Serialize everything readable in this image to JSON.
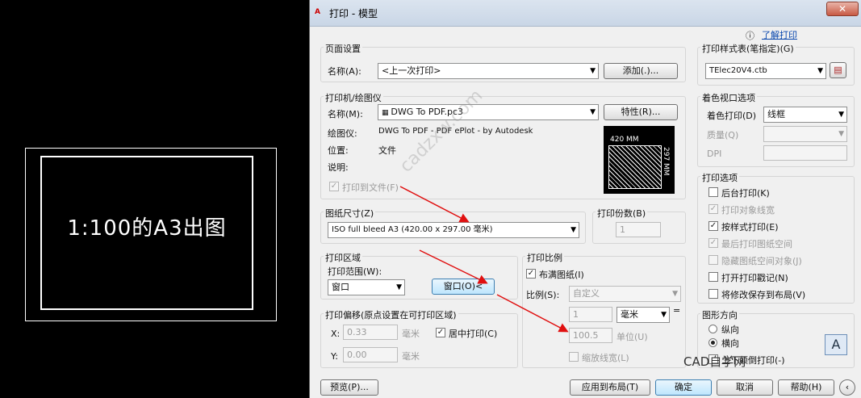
{
  "cad": {
    "drawing_text": "1:100的A3出图"
  },
  "dialog": {
    "title": "打印 - 模型",
    "help_link": "了解打印",
    "page_setup": {
      "group": "页面设置",
      "name_label": "名称(A):",
      "name_value": "<上一次打印>",
      "add_button": "添加(.)..."
    },
    "printer": {
      "group": "打印机/绘图仪",
      "name_label": "名称(M):",
      "name_value": "DWG To PDF.pc3",
      "properties_button": "特性(R)...",
      "plotter_label": "绘图仪:",
      "plotter_value": "DWG To PDF - PDF ePlot - by Autodesk",
      "location_label": "位置:",
      "location_value": "文件",
      "description_label": "说明:",
      "plot_to_file": "打印到文件(F)",
      "preview_width": "420 MM",
      "preview_height": "297 MM"
    },
    "paper_size": {
      "group": "图纸尺寸(Z)",
      "value": "ISO full bleed A3 (420.00 x 297.00 毫米)"
    },
    "copies": {
      "group": "打印份数(B)",
      "value": "1"
    },
    "plot_area": {
      "group": "打印区域",
      "range_label": "打印范围(W):",
      "range_value": "窗口",
      "window_button": "窗口(O)<"
    },
    "plot_offset": {
      "group": "打印偏移(原点设置在可打印区域)",
      "x_label": "X:",
      "x_value": "0.33",
      "y_label": "Y:",
      "y_value": "0.00",
      "unit": "毫米",
      "center_label": "居中打印(C)"
    },
    "plot_scale": {
      "group": "打印比例",
      "fit_label": "布满图纸(I)",
      "scale_label": "比例(S):",
      "scale_value": "自定义",
      "value1": "1",
      "unit_value": "毫米",
      "equals": "=",
      "value2": "100.5",
      "unit2": "单位(U)",
      "scale_lineweights": "缩放线宽(L)"
    },
    "style_table": {
      "group": "打印样式表(笔指定)(G)",
      "value": "TElec20V4.ctb"
    },
    "shaded_viewport": {
      "group": "着色视口选项",
      "shade_label": "着色打印(D)",
      "shade_value": "线框",
      "quality_label": "质量(Q)",
      "dpi_label": "DPI"
    },
    "plot_options": {
      "group": "打印选项",
      "items": [
        "后台打印(K)",
        "打印对象线宽",
        "按样式打印(E)",
        "最后打印图纸空间",
        "隐藏图纸空间对象(J)",
        "打开打印戳记(N)",
        "将修改保存到布局(V)"
      ]
    },
    "orientation": {
      "group": "图形方向",
      "portrait": "纵向",
      "landscape": "横向",
      "upside_down": "上下颠倒打印(-)"
    },
    "buttons": {
      "preview": "预览(P)...",
      "apply": "应用到布局(T)",
      "ok": "确定",
      "cancel": "取消",
      "help": "帮助(H)"
    },
    "watermark": {
      "site": "cadzxw.com",
      "brand": "CAD自学网",
      "letter": "A"
    }
  }
}
